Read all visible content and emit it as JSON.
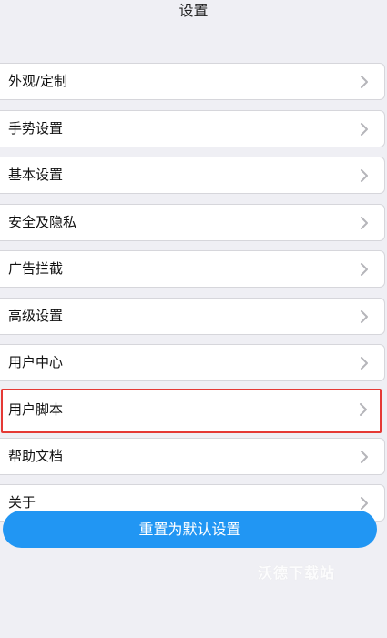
{
  "header": {
    "title": "设置"
  },
  "settings": {
    "items": [
      {
        "label": "外观/定制",
        "highlighted": false
      },
      {
        "label": "手势设置",
        "highlighted": false
      },
      {
        "label": "基本设置",
        "highlighted": false
      },
      {
        "label": "安全及隐私",
        "highlighted": false
      },
      {
        "label": "广告拦截",
        "highlighted": false
      },
      {
        "label": "高级设置",
        "highlighted": false
      },
      {
        "label": "用户中心",
        "highlighted": false
      },
      {
        "label": "用户脚本",
        "highlighted": true
      },
      {
        "label": "帮助文档",
        "highlighted": false
      },
      {
        "label": "关于",
        "highlighted": false
      }
    ]
  },
  "reset_button": {
    "label": "重置为默认设置"
  },
  "watermark": {
    "text": "沃德下载站"
  },
  "icons": {
    "item_arrow": "chevron-right-icon"
  },
  "colors": {
    "background": "#efeff4",
    "button": "#2196f3",
    "highlight_border": "#e53935",
    "chevron": "#b5b5ba"
  }
}
